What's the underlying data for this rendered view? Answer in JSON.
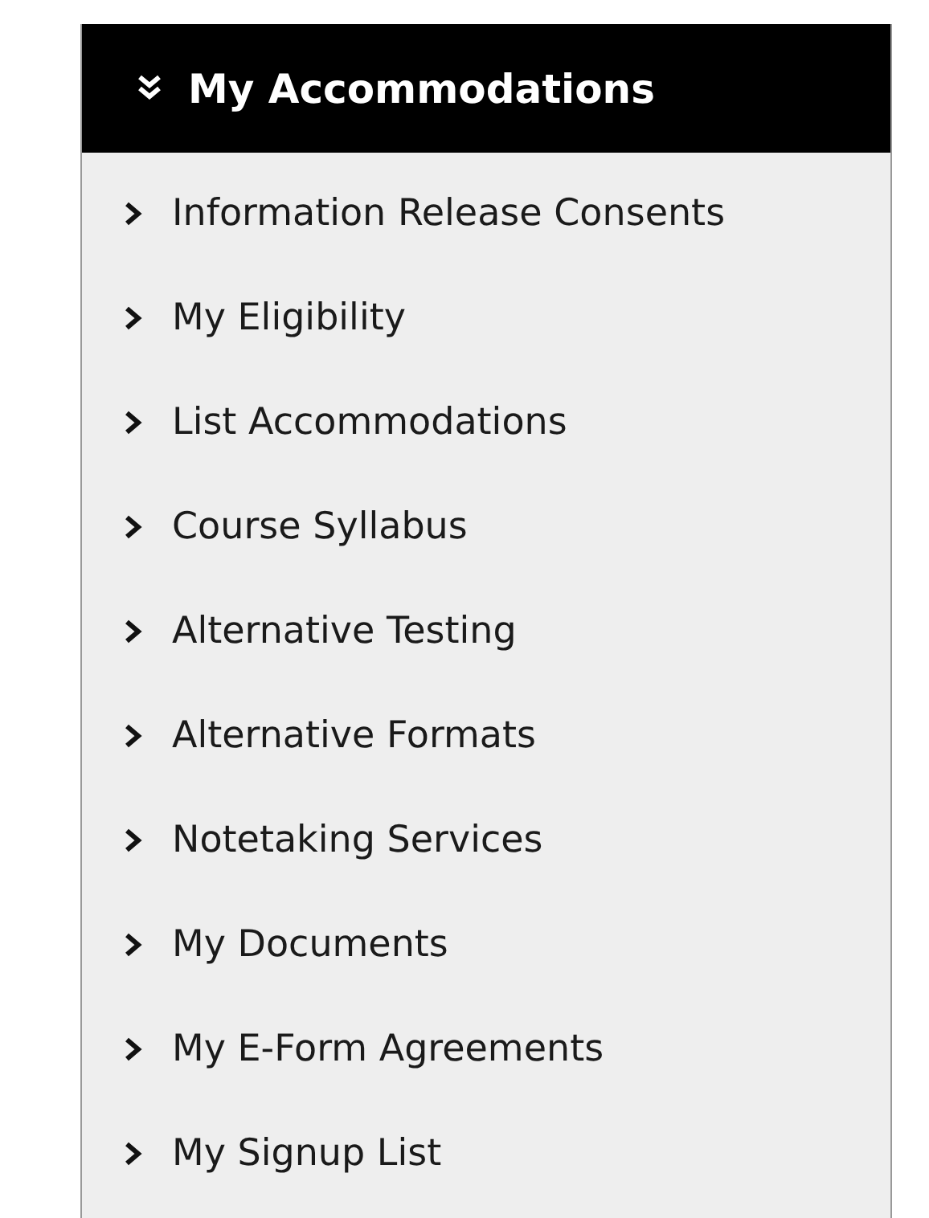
{
  "panel": {
    "title": "My Accommodations",
    "expanded": true
  },
  "items": [
    {
      "label": "Information Release Consents"
    },
    {
      "label": "My Eligibility"
    },
    {
      "label": "List Accommodations"
    },
    {
      "label": "Course Syllabus"
    },
    {
      "label": "Alternative Testing"
    },
    {
      "label": "Alternative Formats"
    },
    {
      "label": "Notetaking Services"
    },
    {
      "label": "My Documents"
    },
    {
      "label": "My E-Form Agreements"
    },
    {
      "label": "My Signup List"
    }
  ]
}
